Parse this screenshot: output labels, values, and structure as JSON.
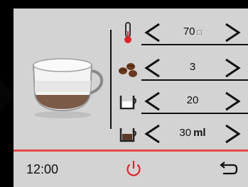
{
  "icons": {
    "play": "play-arrow-icon",
    "drink": "latte-glass-cup-icon",
    "temperature": "thermometer-icon",
    "strength": "coffee-beans-icon",
    "milk": "milk-cup-icon",
    "coffee": "coffee-cup-icon",
    "decrease": "chevron-left-icon",
    "increase": "chevron-right-icon",
    "power": "power-icon",
    "back": "return-arrow-icon"
  },
  "colors": {
    "background": "#d3d3d3",
    "accent": "#e8474b",
    "text": "#111111"
  },
  "settings": {
    "temperature": {
      "value": "70",
      "unit": "□"
    },
    "strength": {
      "value": "3"
    },
    "milk": {
      "value": "20"
    },
    "coffee": {
      "value": "30",
      "unit": "ml"
    }
  },
  "footer": {
    "time": "12:00"
  }
}
